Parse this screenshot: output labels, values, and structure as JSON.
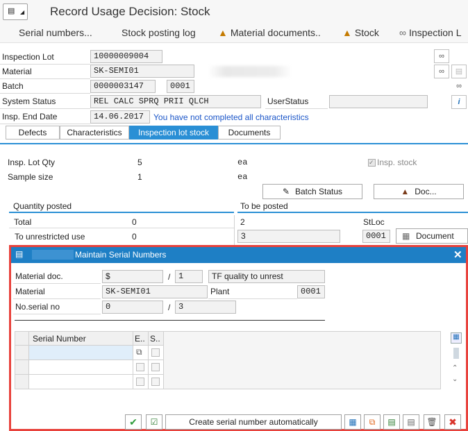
{
  "header": {
    "title": "Record Usage Decision: Stock"
  },
  "toolbar": {
    "serial": "Serial numbers...",
    "stock_log": "Stock posting log",
    "mat_docs": "Material documents..",
    "stock": "Stock",
    "inspection": "Inspection L"
  },
  "fields": {
    "lot_label": "Inspection Lot",
    "lot_value": "10000009004",
    "mat_label": "Material",
    "mat_value": "SK-SEMI01",
    "batch_label": "Batch",
    "batch_value": "0000003147",
    "batch_plant": "0001",
    "status_label": "System Status",
    "status_value": "REL  CALC SPRQ PRII QLCH",
    "user_status_label": "UserStatus",
    "end_label": "Insp. End Date",
    "end_value": "14.06.2017",
    "end_msg": "You have not completed all characteristics"
  },
  "tabs": [
    "Defects",
    "Characteristics",
    "Inspection lot stock",
    "Documents"
  ],
  "stock": {
    "lot_qty_label": "Insp. Lot Qty",
    "lot_qty": "5",
    "lot_qty_unit": "ea",
    "sample_label": "Sample size",
    "sample": "1",
    "sample_unit": "ea",
    "insp_stock": "Insp. stock",
    "batch_status": "Batch Status",
    "doc": "Doc...",
    "qty_posted": "Quantity posted",
    "to_be_posted": "To be posted",
    "total_label": "Total",
    "total": "0",
    "total_post": "2",
    "stloc": "StLoc",
    "unres_label": "To unrestricted use",
    "unres": "0",
    "unres_post": "3",
    "unres_stloc": "0001",
    "document": "Document"
  },
  "dialog": {
    "title": "Maintain Serial Numbers",
    "mat_doc_label": "Material doc.",
    "mat_doc_value": "$",
    "mat_doc_item": "1",
    "mat_doc_desc": "TF quality to unrest",
    "material_label": "Material",
    "material_value": "SK-SEMI01",
    "plant_label": "Plant",
    "plant_value": "0001",
    "serial_no_label": "No.serial no",
    "serial_no_value": "0",
    "serial_no_total": "3",
    "col_serial": "Serial Number",
    "col_e": "E..",
    "col_s": "S..",
    "create_btn": "Create serial number automatically"
  }
}
